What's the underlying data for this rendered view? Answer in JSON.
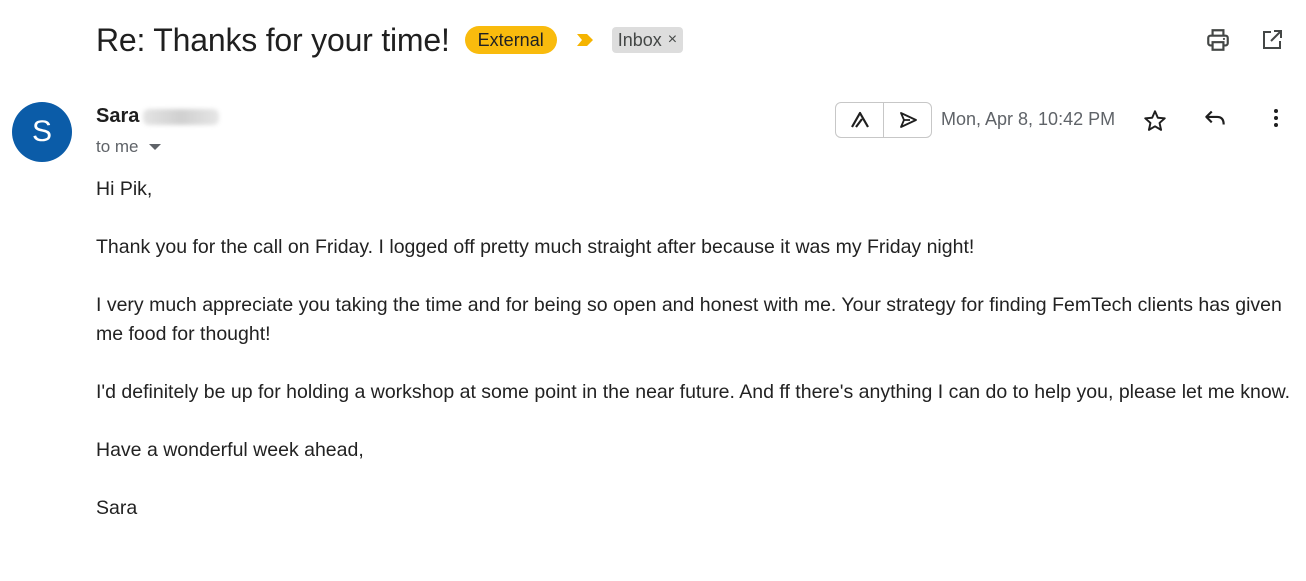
{
  "subject": "Re: Thanks for your time!",
  "labels": {
    "external": "External",
    "inbox": "Inbox",
    "inbox_remove": "×"
  },
  "colors": {
    "external_badge": "#f9bb0d",
    "importance_marker": "#f5b400",
    "avatar": "#0b5ca8",
    "inbox_chip": "#dddddd"
  },
  "top_actions": [
    "print-icon",
    "open-in-new-window-icon"
  ],
  "message": {
    "avatar_letter": "S",
    "sender_name": "Sara",
    "recipient": "to me",
    "date": "Mon, Apr 8, 10:42 PM",
    "extension_icons": [
      "extension-logo-icon",
      "send-icon"
    ],
    "action_icons": [
      "star-icon",
      "reply-icon",
      "more-vertical-icon"
    ]
  },
  "body": {
    "greeting": "Hi Pik,",
    "paragraphs": [
      "Thank you for the call on Friday. I logged off pretty much straight after because it was my Friday night!",
      "I very much appreciate you taking the time and for being so open and honest with me. Your strategy for finding FemTech clients has given me food for thought!",
      "I'd definitely be up for holding a workshop at some point in the near future. And ff there's anything I can do to help you, please let me know."
    ],
    "closing": "Have a wonderful week ahead,",
    "signature": "Sara"
  }
}
